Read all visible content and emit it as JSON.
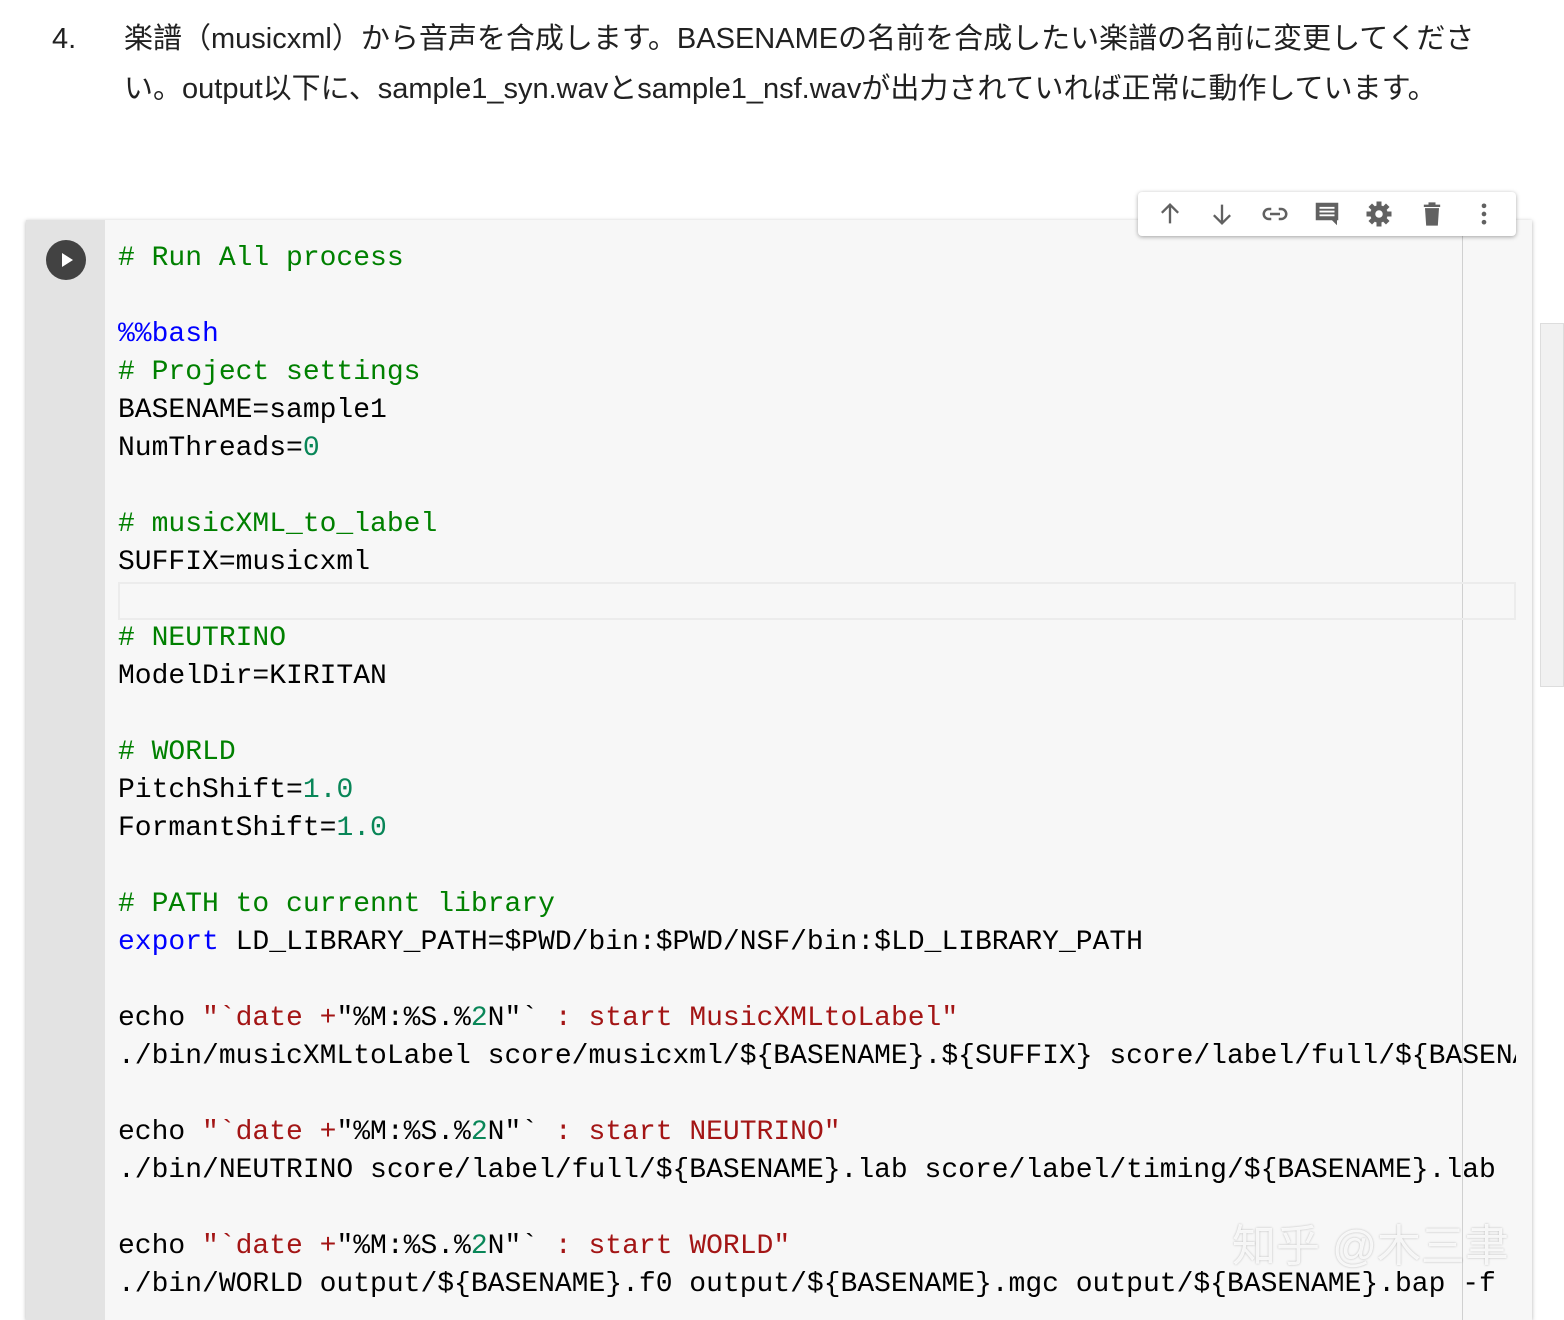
{
  "markdown": {
    "number": "4.",
    "text": "楽譜（musicxml）から音声を合成します。BASENAMEの名前を合成したい楽譜の名前に変更してください。output以下に、sample1_syn.wavとsample1_nsf.wavが出力されていれば正常に動作しています。"
  },
  "toolbar": {
    "icons": [
      "arrow-up-icon",
      "arrow-down-icon",
      "link-icon",
      "comment-icon",
      "gear-icon",
      "trash-icon",
      "more-vert-icon"
    ]
  },
  "colors": {
    "comment": "#008000",
    "keyword": "#0000ff",
    "number": "#098658",
    "string": "#a31515"
  },
  "code": [
    [
      [
        "# Run All process",
        "comment"
      ]
    ],
    [],
    [
      [
        "%%bash",
        "keyword"
      ]
    ],
    [
      [
        "# Project settings",
        "comment"
      ]
    ],
    [
      [
        "BASENAME=sample1",
        "plain"
      ]
    ],
    [
      [
        "NumThreads=",
        "plain"
      ],
      [
        "0",
        "number"
      ]
    ],
    [],
    [
      [
        "# musicXML_to_label",
        "comment"
      ]
    ],
    [
      [
        "SUFFIX=musicxml",
        "plain"
      ]
    ],
    [],
    [
      [
        "# NEUTRINO",
        "comment"
      ]
    ],
    [
      [
        "ModelDir=KIRITAN",
        "plain"
      ]
    ],
    [],
    [
      [
        "# WORLD",
        "comment"
      ]
    ],
    [
      [
        "PitchShift=",
        "plain"
      ],
      [
        "1.0",
        "number"
      ]
    ],
    [
      [
        "FormantShift=",
        "plain"
      ],
      [
        "1.0",
        "number"
      ]
    ],
    [],
    [
      [
        "# PATH to currennt library",
        "comment"
      ]
    ],
    [
      [
        "export",
        "keyword"
      ],
      [
        " LD_LIBRARY_PATH=$PWD/bin:$PWD/NSF/bin:$LD_LIBRARY_PATH",
        "plain"
      ]
    ],
    [],
    [
      [
        "echo ",
        "plain"
      ],
      [
        "\"`date +",
        "string"
      ],
      [
        "\"%M:%S.%",
        "plain"
      ],
      [
        "2",
        "number"
      ],
      [
        "N\"`",
        "plain"
      ],
      [
        " : start MusicXMLtoLabel\"",
        "string"
      ]
    ],
    [
      [
        "./bin/musicXMLtoLabel score/musicxml/${BASENAME}.${SUFFIX} score/label/full/${BASENAME}.lab",
        "plain"
      ]
    ],
    [],
    [
      [
        "echo ",
        "plain"
      ],
      [
        "\"`date +",
        "string"
      ],
      [
        "\"%M:%S.%",
        "plain"
      ],
      [
        "2",
        "number"
      ],
      [
        "N\"`",
        "plain"
      ],
      [
        " : start NEUTRINO\"",
        "string"
      ]
    ],
    [
      [
        "./bin/NEUTRINO score/label/full/${BASENAME}.lab score/label/timing/${BASENAME}.lab",
        "plain"
      ]
    ],
    [],
    [
      [
        "echo ",
        "plain"
      ],
      [
        "\"`date +",
        "string"
      ],
      [
        "\"%M:%S.%",
        "plain"
      ],
      [
        "2",
        "number"
      ],
      [
        "N\"`",
        "plain"
      ],
      [
        " : start WORLD\"",
        "string"
      ]
    ],
    [
      [
        "./bin/WORLD output/${BASENAME}.f0 output/${BASENAME}.mgc output/${BASENAME}.bap -f ",
        "plain"
      ]
    ]
  ],
  "current_line": 9,
  "watermark": "知乎 @木三聿"
}
